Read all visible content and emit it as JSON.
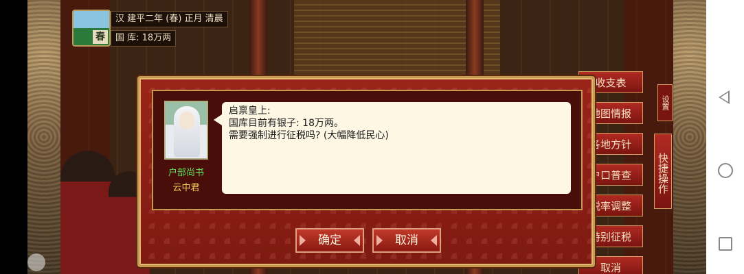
{
  "hud": {
    "season_badge": "春",
    "date": "汉 建平二年 (春) 正月 清晨",
    "treasury": "国 库: 18万两"
  },
  "menu": {
    "items": [
      "收支表",
      "地图情报",
      "各地方针",
      "户口普查",
      "税率调整",
      "特别征税",
      "取消"
    ],
    "quick": "快捷操作",
    "settings": "设置"
  },
  "dialog": {
    "role": "户部尚书",
    "name": "云中君",
    "lines": [
      "启禀皇上:",
      "国库目前有银子: 18万两。",
      "需要强制进行征税吗? (大幅降低民心)"
    ],
    "confirm": "确定",
    "cancel": "取消"
  },
  "colors": {
    "dialog_red": "#8e1f15",
    "gold_border": "#c99a52",
    "role_green": "#5ee05a",
    "name_yellow": "#f0d060"
  },
  "icons": [
    "back-icon",
    "home-icon",
    "recent-apps-icon",
    "settings-gear-icon"
  ]
}
